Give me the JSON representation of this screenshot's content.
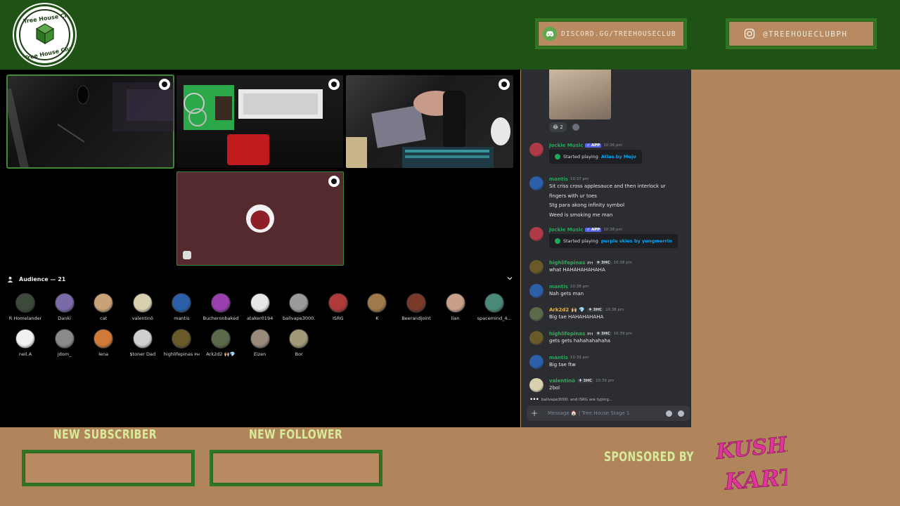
{
  "header": {
    "logo_text_top": "Tree House Club",
    "logo_text_bottom": "Tree House Club",
    "discord_label": "DISCORD.GG/TREEHOUSECLUB",
    "instagram_label": "@TREEHOUECLUBPH"
  },
  "stage": {
    "audience_label": "Audience — 21",
    "audience": [
      {
        "name": "R Homelander",
        "color": "#3c4a3a"
      },
      {
        "name": "Danki",
        "color": "#7a6aa8"
      },
      {
        "name": "cat",
        "color": "#c9a27a"
      },
      {
        "name": "valentinō",
        "color": "#d9d0b0"
      },
      {
        "name": "mantis",
        "color": "#2c5fa8"
      },
      {
        "name": "Bucheronbaked",
        "color": "#9a3fb0"
      },
      {
        "name": "ataker0194",
        "color": "#e8e8e8"
      },
      {
        "name": "ballvape3000.",
        "color": "#9a9a9a"
      },
      {
        "name": "ISRG",
        "color": "#b03a3a"
      },
      {
        "name": "K",
        "color": "#a07a4a"
      },
      {
        "name": "Beerandjoint",
        "color": "#7a3a2a"
      },
      {
        "name": "lian",
        "color": "#c8a08a"
      },
      {
        "name": "spacemind_4...",
        "color": "#4a8a7a"
      },
      {
        "name": "neil.A",
        "color": "#f0f0f0"
      },
      {
        "name": "jdom_",
        "color": "#8a8a8a"
      },
      {
        "name": "lena",
        "color": "#d07a3a"
      },
      {
        "name": "$toner Dad",
        "color": "#cfcfcf"
      },
      {
        "name": "highlifepinas ᴘʜ",
        "color": "#6a5a2a"
      },
      {
        "name": "Ark2d2 🙌🏼💎",
        "color": "#5a6a4a"
      },
      {
        "name": "Eizen",
        "color": "#9a8a7a"
      },
      {
        "name": "Bor",
        "color": "#a09a7a"
      }
    ]
  },
  "chat": {
    "reaction_count": "2",
    "messages": [
      {
        "user": "Jockie Music",
        "badge": "✓ APP",
        "time": "10:36 pm",
        "embed_prefix": "Started playing",
        "embed_link": "Atlas by Mujo"
      },
      {
        "user": "mantis",
        "time": "10:37 pm",
        "lines": [
          "Sit criss cross applesauce and then interlock ur",
          "fingers with ur toes",
          "Stg para akong infinity symbol",
          "Weed is smoking me man"
        ]
      },
      {
        "user": "Jockie Music",
        "badge": "✓ APP",
        "time": "10:38 pm",
        "embed_prefix": "Started playing",
        "embed_link": "purple skies by yungmerrin"
      },
      {
        "user": "highlifepinas",
        "suffix": "ᴘʜ",
        "tag": "✚ 3HC",
        "time": "10:38 pm",
        "lines": [
          "what HAHAHAHAHAHA"
        ]
      },
      {
        "user": "mantis",
        "time": "10:38 pm",
        "lines": [
          "Nah gets man"
        ]
      },
      {
        "user": "Ark2d2",
        "suffix": "🙌🏼 💎",
        "tag": "✚ 3HC",
        "time": "10:38 pm",
        "lines": [
          "Big tae HAHAHAHAHA"
        ]
      },
      {
        "user": "highlifepinas",
        "suffix": "ᴘʜ",
        "tag": "✚ 3HC",
        "time": "10:39 pm",
        "lines": [
          "gets gets hahahahahaha"
        ]
      },
      {
        "user": "mantis",
        "time": "10:39 pm",
        "lines": [
          "Big tae ftw"
        ]
      },
      {
        "user": "valentinō",
        "tag": "✚ 3HC",
        "time": "10:39 pm",
        "lines": [
          "2bol"
        ]
      }
    ],
    "typing_users": "ballvape3000. and ISRG are typing...",
    "input_placeholder": "Message 🏠 | Tree House Stage 1"
  },
  "overlay": {
    "new_subscriber": "NEW SUBSCRIBER",
    "new_follower": "NEW FOLLOWER",
    "sponsored_by": "SPONSORED BY",
    "sponsor_logo_text": "KUSHLA KARTS"
  },
  "colors": {
    "header_bg": "#1f5316",
    "overlay_bg": "#b0855c",
    "accent_green": "#2f7524",
    "alert_text": "#d7ea9a",
    "jockie_name": "#23a55a",
    "user_green": "#3ba55c",
    "user_yellow": "#f0b232",
    "link_blue": "#00a8fc",
    "sponsor_pink": "#e0359b"
  }
}
